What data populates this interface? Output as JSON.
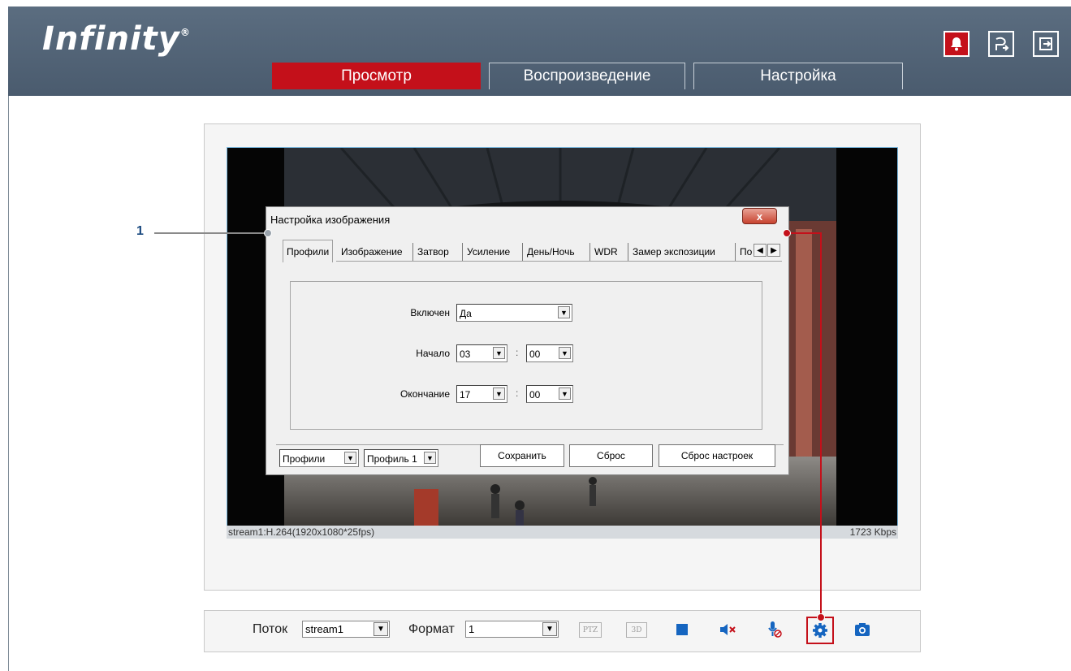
{
  "header": {
    "brand": "Infinity",
    "brand_mark": "®",
    "tabs": [
      {
        "label": "Просмотр",
        "active": true
      },
      {
        "label": "Воспроизведение",
        "active": false
      },
      {
        "label": "Настройка",
        "active": false
      }
    ],
    "buttons": [
      {
        "icon": "alarm-bell-icon"
      },
      {
        "icon": "logout-user-icon"
      },
      {
        "icon": "exit-icon"
      }
    ]
  },
  "video": {
    "stream_info": "stream1:H.264(1920x1080*25fps)",
    "bitrate": "1723 Kbps"
  },
  "dialog": {
    "title": "Настройка изображения",
    "close_glyph": "x",
    "tabs": [
      "Профили",
      "Изображение",
      "Затвор",
      "Усиление",
      "День/Ночь",
      "WDR",
      "Замер экспозиции",
      "По"
    ],
    "active_tab": "Профили",
    "fields": {
      "enabled_label": "Включен",
      "enabled_value": "Да",
      "start_label": "Начало",
      "start_hour": "03",
      "start_min": "00",
      "end_label": "Окончание",
      "end_hour": "17",
      "end_min": "00",
      "colon": ":"
    },
    "bottom": {
      "mode_select": "Профили",
      "profile_select": "Профиль 1",
      "save": "Сохранить",
      "reset": "Сброс",
      "factory_reset": "Сброс настроек"
    }
  },
  "toolbar": {
    "stream_label": "Поток",
    "stream_value": "stream1",
    "format_label": "Формат",
    "format_value": "1",
    "ptz_label": "PTZ",
    "3d_label": "3D"
  },
  "callout": {
    "number": "1"
  },
  "colors": {
    "header_bg": "#4f6073",
    "active_tab": "#c4101a",
    "annotation_red": "#c4101a",
    "callout_blue": "#1a4a80",
    "toolbar_icon_blue": "#1565c0"
  }
}
